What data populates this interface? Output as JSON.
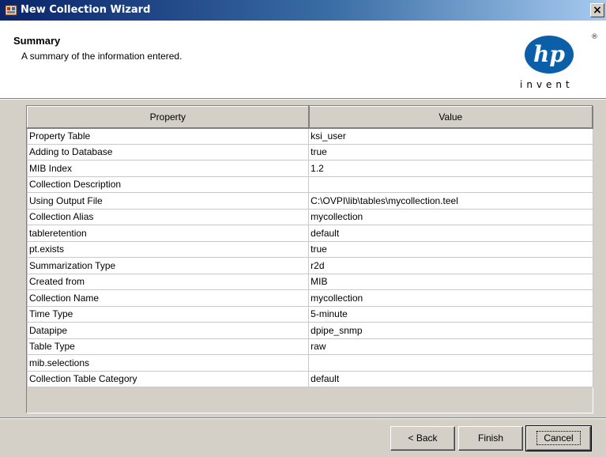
{
  "window": {
    "title": "New Collection Wizard",
    "close_glyph": "×"
  },
  "header": {
    "title": "Summary",
    "subtitle": "A summary of the information entered.",
    "logo": {
      "mark": "hp",
      "tagline": "invent",
      "registered": "®"
    }
  },
  "table": {
    "columns": [
      "Property",
      "Value"
    ],
    "rows": [
      {
        "property": "Property Table",
        "value": "ksi_user"
      },
      {
        "property": "Adding to Database",
        "value": "true"
      },
      {
        "property": "MIB Index",
        "value": "1.2"
      },
      {
        "property": "Collection Description",
        "value": ""
      },
      {
        "property": "Using Output File",
        "value": "C:\\OVPI\\lib\\tables\\mycollection.teel"
      },
      {
        "property": "Collection Alias",
        "value": "mycollection"
      },
      {
        "property": "tableretention",
        "value": "default"
      },
      {
        "property": "pt.exists",
        "value": "true"
      },
      {
        "property": "Summarization Type",
        "value": "r2d"
      },
      {
        "property": "Created from",
        "value": "MIB"
      },
      {
        "property": "Collection Name",
        "value": "mycollection"
      },
      {
        "property": "Time Type",
        "value": "5-minute"
      },
      {
        "property": "Datapipe",
        "value": "dpipe_snmp"
      },
      {
        "property": "Table Type",
        "value": "raw"
      },
      {
        "property": "mib.selections",
        "value": ""
      },
      {
        "property": "Collection Table Category",
        "value": "default"
      }
    ]
  },
  "buttons": {
    "back": "< Back",
    "finish": "Finish",
    "cancel": "Cancel"
  },
  "colors": {
    "titlebar_start": "#0a246a",
    "titlebar_end": "#a6caf0",
    "dialog_bg": "#d4d0c8",
    "hp_blue": "#0a5fa8"
  }
}
